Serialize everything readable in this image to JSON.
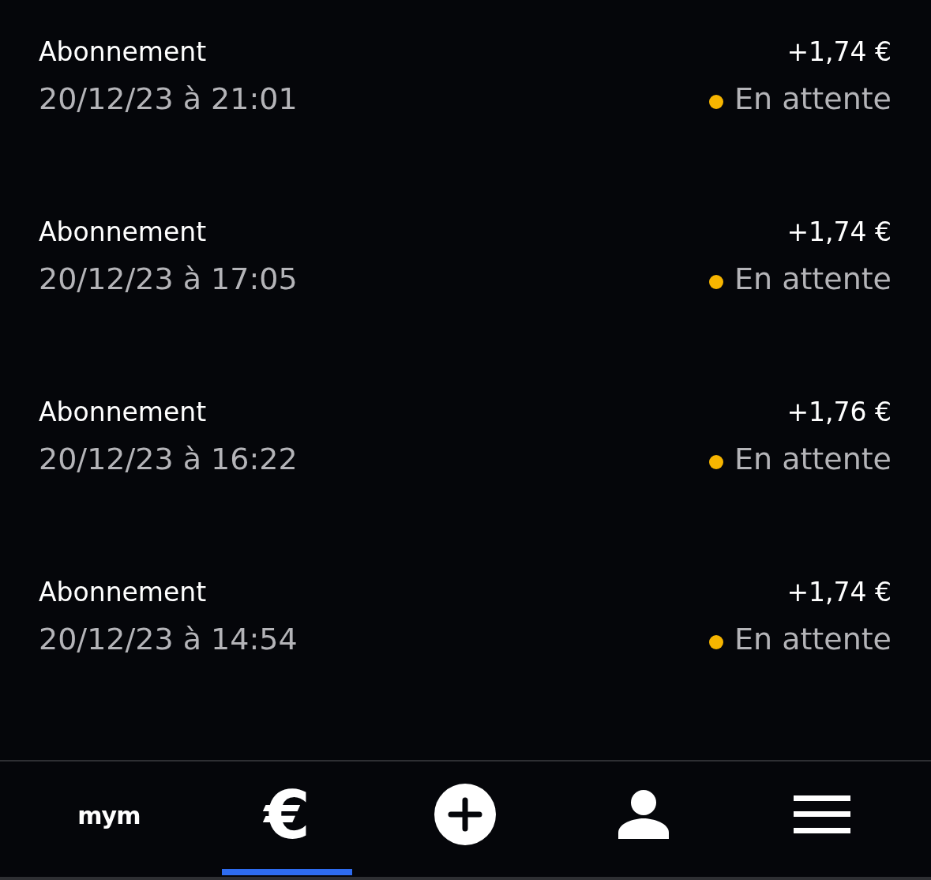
{
  "transactions": [
    {
      "title": "Abonnement",
      "date": "20/12/23 à 21:01",
      "amount": "+1,74 €",
      "status": "En attente",
      "color": "#f7b500"
    },
    {
      "title": "Abonnement",
      "date": "20/12/23 à 17:05",
      "amount": "+1,74 €",
      "status": "En attente",
      "color": "#f7b500"
    },
    {
      "title": "Abonnement",
      "date": "20/12/23 à 16:22",
      "amount": "+1,76 €",
      "status": "En attente",
      "color": "#f7b500"
    },
    {
      "title": "Abonnement",
      "date": "20/12/23 à 14:54",
      "amount": "+1,74 €",
      "status": "En attente",
      "color": "#f7b500"
    }
  ],
  "nav": [
    {
      "kind": "logo",
      "label": "mym",
      "selected": false
    },
    {
      "kind": "glyph",
      "label": "€",
      "selected": true
    },
    {
      "kind": "plus",
      "selected": false
    },
    {
      "kind": "person",
      "selected": false
    },
    {
      "kind": "menu",
      "selected": false
    }
  ]
}
